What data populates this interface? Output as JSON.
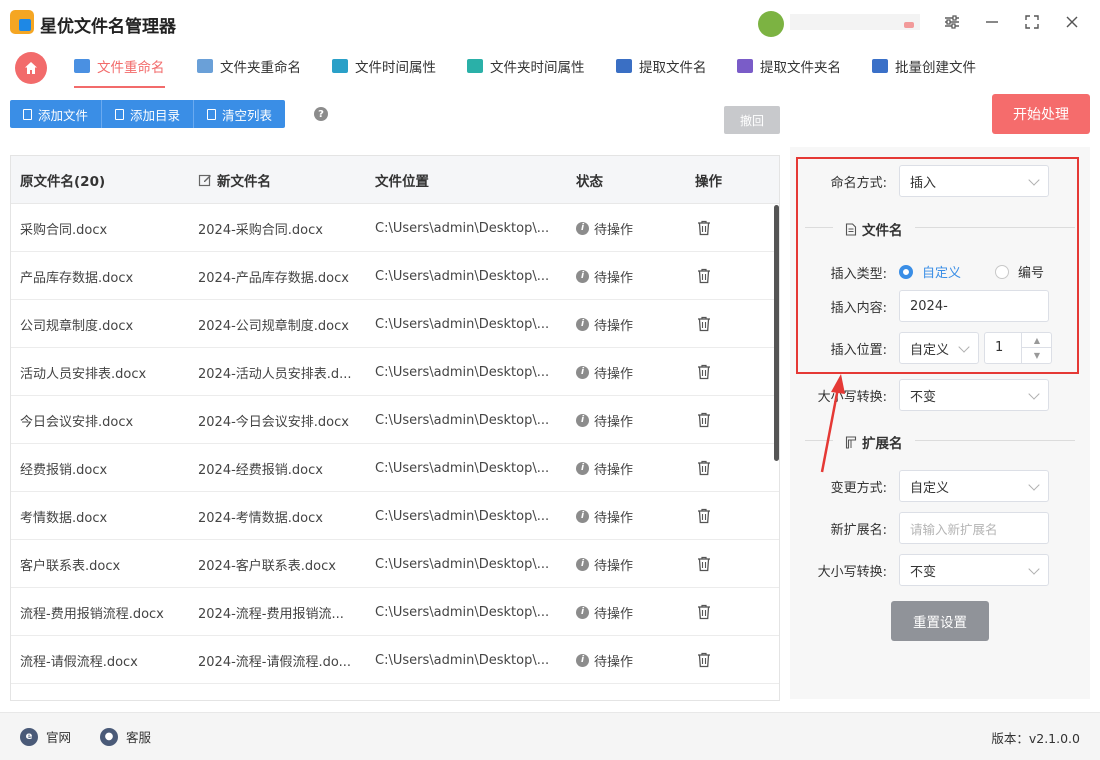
{
  "app": {
    "title": "星优文件名管理器"
  },
  "tabs": [
    {
      "label": "文件重命名",
      "active": true,
      "icon": "rename-file-icon",
      "color": "#4a90e2"
    },
    {
      "label": "文件夹重命名",
      "active": false,
      "icon": "rename-folder-icon",
      "color": "#6aa0d8"
    },
    {
      "label": "文件时间属性",
      "active": false,
      "icon": "file-time-icon",
      "color": "#2aa0c8"
    },
    {
      "label": "文件夹时间属性",
      "active": false,
      "icon": "folder-time-icon",
      "color": "#2ab0a8"
    },
    {
      "label": "提取文件名",
      "active": false,
      "icon": "extract-filename-icon",
      "color": "#3a6fc4"
    },
    {
      "label": "提取文件夹名",
      "active": false,
      "icon": "extract-foldername-icon",
      "color": "#7a5cc8"
    },
    {
      "label": "批量创建文件",
      "active": false,
      "icon": "batch-create-icon",
      "color": "#3a70c8"
    }
  ],
  "toolbar": {
    "add_file": "添加文件",
    "add_dir": "添加目录",
    "clear_list": "清空列表",
    "help": "?",
    "undo": "撤回",
    "start": "开始处理"
  },
  "table": {
    "headers": {
      "original": "原文件名(20)",
      "new": "新文件名",
      "location": "文件位置",
      "status": "状态",
      "action": "操作"
    },
    "rows": [
      {
        "original": "采购合同.docx",
        "new": "2024-采购合同.docx",
        "location": "C:\\Users\\admin\\Desktop\\...",
        "status": "待操作"
      },
      {
        "original": "产品库存数据.docx",
        "new": "2024-产品库存数据.docx",
        "location": "C:\\Users\\admin\\Desktop\\...",
        "status": "待操作"
      },
      {
        "original": "公司规章制度.docx",
        "new": "2024-公司规章制度.docx",
        "location": "C:\\Users\\admin\\Desktop\\...",
        "status": "待操作"
      },
      {
        "original": "活动人员安排表.docx",
        "new": "2024-活动人员安排表.d...",
        "location": "C:\\Users\\admin\\Desktop\\...",
        "status": "待操作"
      },
      {
        "original": "今日会议安排.docx",
        "new": "2024-今日会议安排.docx",
        "location": "C:\\Users\\admin\\Desktop\\...",
        "status": "待操作"
      },
      {
        "original": "经费报销.docx",
        "new": "2024-经费报销.docx",
        "location": "C:\\Users\\admin\\Desktop\\...",
        "status": "待操作"
      },
      {
        "original": "考情数据.docx",
        "new": "2024-考情数据.docx",
        "location": "C:\\Users\\admin\\Desktop\\...",
        "status": "待操作"
      },
      {
        "original": "客户联系表.docx",
        "new": "2024-客户联系表.docx",
        "location": "C:\\Users\\admin\\Desktop\\...",
        "status": "待操作"
      },
      {
        "original": "流程-费用报销流程.docx",
        "new": "2024-流程-费用报销流...",
        "location": "C:\\Users\\admin\\Desktop\\...",
        "status": "待操作"
      },
      {
        "original": "流程-请假流程.docx",
        "new": "2024-流程-请假流程.do...",
        "location": "C:\\Users\\admin\\Desktop\\...",
        "status": "待操作"
      }
    ]
  },
  "panel": {
    "naming_mode_label": "命名方式:",
    "naming_mode_value": "插入",
    "filename_section": "文件名",
    "insert_type_label": "插入类型:",
    "insert_type_custom": "自定义",
    "insert_type_number": "编号",
    "insert_content_label": "插入内容:",
    "insert_content_value": "2024-",
    "insert_position_label": "插入位置:",
    "insert_position_value": "自定义",
    "insert_position_number": "1",
    "case_label": "大小写转换:",
    "case_value": "不变",
    "ext_section": "扩展名",
    "change_mode_label": "变更方式:",
    "change_mode_value": "自定义",
    "new_ext_label": "新扩展名:",
    "new_ext_placeholder": "请输入新扩展名",
    "ext_case_label": "大小写转换:",
    "ext_case_value": "不变",
    "reset": "重置设置"
  },
  "footer": {
    "website": "官网",
    "support": "客服",
    "version": "版本：v2.1.0.0"
  },
  "colors": {
    "accent_red": "#f26b6b",
    "primary_blue": "#3a8ee6",
    "highlight": "#e53935"
  }
}
